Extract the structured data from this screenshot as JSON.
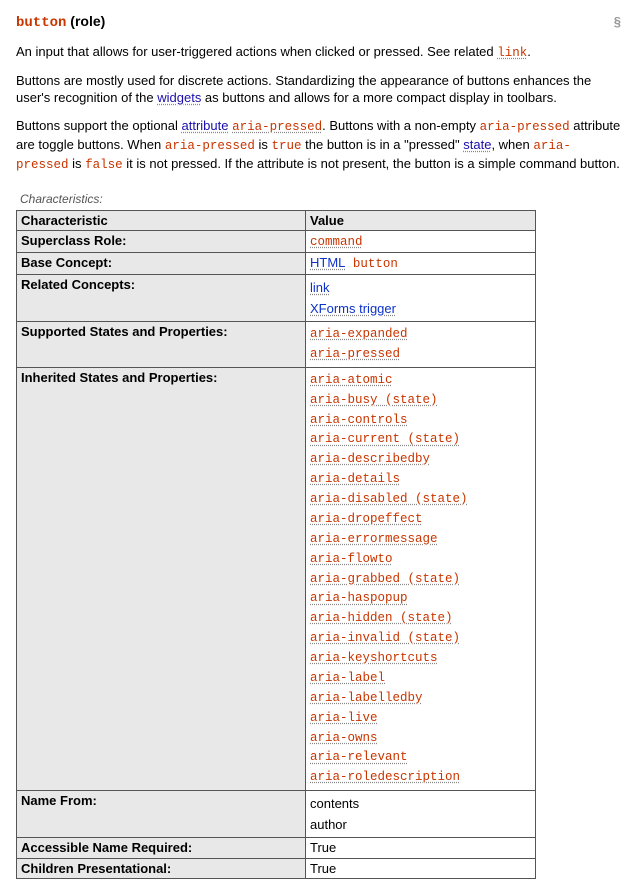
{
  "header": {
    "role_code": "button",
    "role_suffix": " (role)",
    "permalink": "§"
  },
  "intro": {
    "p1_pre": "An input that allows for user-triggered actions when clicked or pressed. See related ",
    "p1_link": "link",
    "p1_post": ".",
    "p2_pre": "Buttons are mostly used for discrete actions. Standardizing the appearance of buttons enhances the user's recognition of the ",
    "p2_link": "widgets",
    "p2_post": " as buttons and allows for a more compact display in toolbars.",
    "p3_a": "Buttons support the optional ",
    "p3_attr_word": "attribute",
    "p3_sp": " ",
    "p3_aria1": "aria-pressed",
    "p3_b": ". Buttons with a non-empty ",
    "p3_aria2": "aria-pressed",
    "p3_c": " attribute are toggle buttons. When ",
    "p3_aria3": "aria-pressed",
    "p3_d": " is ",
    "p3_true": "true",
    "p3_e": " the button is in a \"pressed\" ",
    "p3_state": "state",
    "p3_f": ", when ",
    "p3_aria4": "aria-pressed",
    "p3_g": " is ",
    "p3_false": "false",
    "p3_h": " it is not pressed. If the attribute is not present, the button is a simple command button."
  },
  "table": {
    "caption": "Characteristics:",
    "head_char": "Characteristic",
    "head_value": "Value",
    "rows": {
      "superclass": {
        "label": "Superclass Role:",
        "value_link": "command"
      },
      "base_concept": {
        "label": "Base Concept:",
        "html_link": "HTML",
        "button_code": " button"
      },
      "related_concepts": {
        "label": "Related Concepts:",
        "items": [
          "link",
          "XForms trigger"
        ]
      },
      "supported": {
        "label": "Supported States and Properties:",
        "items": [
          "aria-expanded",
          "aria-pressed"
        ]
      },
      "inherited": {
        "label": "Inherited States and Properties:",
        "items": [
          "aria-atomic",
          "aria-busy (state)",
          "aria-controls",
          "aria-current (state)",
          "aria-describedby",
          "aria-details",
          "aria-disabled (state)",
          "aria-dropeffect",
          "aria-errormessage",
          "aria-flowto",
          "aria-grabbed (state)",
          "aria-haspopup",
          "aria-hidden (state)",
          "aria-invalid (state)",
          "aria-keyshortcuts",
          "aria-label",
          "aria-labelledby",
          "aria-live",
          "aria-owns",
          "aria-relevant",
          "aria-roledescription"
        ]
      },
      "name_from": {
        "label": "Name From:",
        "items": [
          "contents",
          "author"
        ]
      },
      "acc_name_req": {
        "label": "Accessible Name Required:",
        "value": "True"
      },
      "children_pres": {
        "label": "Children Presentational:",
        "value": "True"
      }
    }
  }
}
